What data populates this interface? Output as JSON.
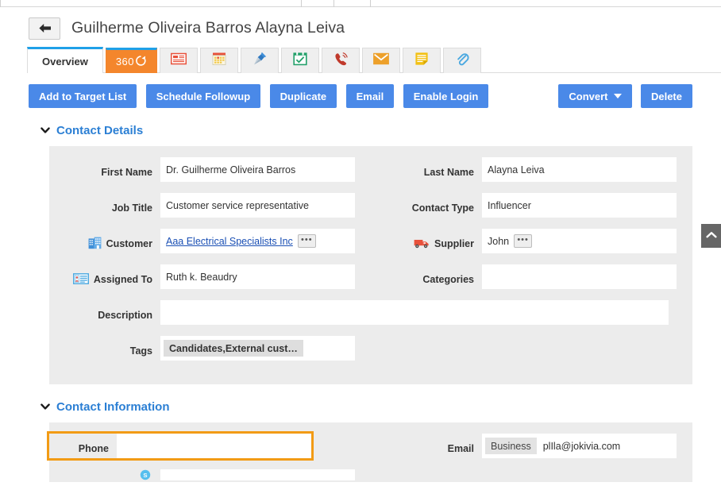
{
  "header": {
    "back_icon": "back-arrow-icon",
    "title": "Guilherme Oliveira Barros Alayna Leiva"
  },
  "tabs": [
    {
      "label": "Overview",
      "icon": "",
      "state": "active",
      "name": "tab-overview"
    },
    {
      "label": "360",
      "icon": "refresh-circle-icon",
      "state": "highlight",
      "name": "tab-360"
    },
    {
      "label": "",
      "icon": "news-list-icon",
      "state": "normal",
      "name": "tab-news"
    },
    {
      "label": "",
      "icon": "calendar-icon",
      "state": "normal",
      "name": "tab-calendar"
    },
    {
      "label": "",
      "icon": "pin-icon",
      "state": "normal",
      "name": "tab-pin"
    },
    {
      "label": "",
      "icon": "task-check-icon",
      "state": "normal",
      "name": "tab-tasks"
    },
    {
      "label": "",
      "icon": "phone-call-icon",
      "state": "normal",
      "name": "tab-calls"
    },
    {
      "label": "",
      "icon": "envelope-icon",
      "state": "normal",
      "name": "tab-emails"
    },
    {
      "label": "",
      "icon": "notes-icon",
      "state": "normal",
      "name": "tab-notes"
    },
    {
      "label": "",
      "icon": "paperclip-icon",
      "state": "normal",
      "name": "tab-attachments"
    }
  ],
  "actions": {
    "left": [
      {
        "label": "Add to Target List",
        "name": "add-to-target-list-button"
      },
      {
        "label": "Schedule Followup",
        "name": "schedule-followup-button"
      },
      {
        "label": "Duplicate",
        "name": "duplicate-button"
      },
      {
        "label": "Email",
        "name": "email-button"
      },
      {
        "label": "Enable Login",
        "name": "enable-login-button"
      }
    ],
    "right": [
      {
        "label": "Convert",
        "name": "convert-button",
        "has_caret": true
      },
      {
        "label": "Delete",
        "name": "delete-button",
        "has_caret": false
      }
    ]
  },
  "panels": [
    {
      "title": "Contact Details",
      "name": "panel-contact-details",
      "rows": [
        {
          "left": {
            "label": "First Name",
            "value": "Dr. Guilherme Oliveira Barros",
            "name": "first-name"
          },
          "right": {
            "label": "Last Name",
            "value": "Alayna Leiva",
            "name": "last-name"
          }
        },
        {
          "left": {
            "label": "Job Title",
            "value": "Customer service representative",
            "name": "job-title"
          },
          "right": {
            "label": "Contact Type",
            "value": "Influencer",
            "name": "contact-type"
          }
        },
        {
          "left": {
            "label": "Customer",
            "value": "Aaa Electrical Specialists Inc",
            "icon": "building-icon",
            "link": true,
            "more": "•••",
            "name": "customer"
          },
          "right": {
            "label": "Supplier",
            "value": "John",
            "icon": "truck-icon",
            "more": "•••",
            "name": "supplier"
          }
        },
        {
          "left": {
            "label": "Assigned To",
            "value": "Ruth k. Beaudry",
            "icon": "id-card-icon",
            "name": "assigned-to"
          },
          "right": {
            "label": "Categories",
            "value": "",
            "name": "categories"
          }
        },
        {
          "left": {
            "label": "Description",
            "value": "",
            "wide": true,
            "name": "description"
          }
        },
        {
          "left": {
            "label": "Tags",
            "value": "Candidates,External cust…",
            "chip": true,
            "name": "tags"
          }
        }
      ]
    },
    {
      "title": "Contact Information",
      "name": "panel-contact-information",
      "rows": [
        {
          "left": {
            "label": "Phone",
            "value": "",
            "highlight": true,
            "name": "phone"
          },
          "right": {
            "label": "Email",
            "value": "plIla@jokivia.com",
            "chip_prefix": "Business",
            "name": "email"
          }
        }
      ]
    }
  ],
  "scroll_top": {
    "icon": "chevron-up-icon",
    "name": "scroll-to-top-button"
  },
  "colors": {
    "accent_blue": "#4a89e8",
    "tab_active_underline": "#1fa0e8",
    "tab_360_orange": "#f4862c",
    "panel_bg": "#ececec",
    "link_blue": "#1a4fb4",
    "section_title": "#2b7fd4",
    "highlight_orange": "#f29b15"
  }
}
